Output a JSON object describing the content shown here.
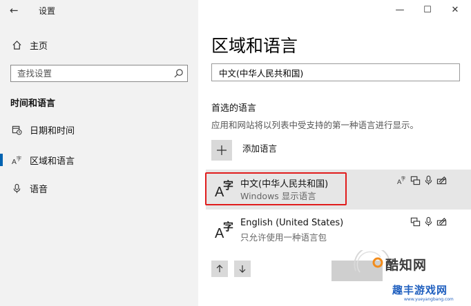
{
  "window": {
    "app_title": "设置",
    "back_glyph": "←",
    "minimize_glyph": "—",
    "maximize_glyph": "☐",
    "close_glyph": "✕"
  },
  "sidebar": {
    "home_label": "主页",
    "search_placeholder": "查找设置",
    "section_header": "时间和语言",
    "items": [
      {
        "label": "日期和时间",
        "icon": "calendar-clock-icon",
        "active": false
      },
      {
        "label": "区域和语言",
        "icon": "language-icon",
        "active": true
      },
      {
        "label": "语音",
        "icon": "microphone-icon",
        "active": false
      }
    ]
  },
  "main": {
    "page_title": "区域和语言",
    "country_value": "中文(中华人民共和国)",
    "preferred_title": "首选的语言",
    "preferred_desc": "应用和网站将以列表中受支持的第一种语言进行显示。",
    "add_language_label": "添加语言",
    "languages": [
      {
        "name": "中文(中华人民共和国)",
        "sub": "Windows 显示语言",
        "selected": true
      },
      {
        "name": "English (United States)",
        "sub": "只允许使用一种语言包",
        "selected": false
      }
    ]
  },
  "watermark": {
    "text1": "酷知网",
    "text2": "趣丰游戏网",
    "url": "www.yueyangbang.com"
  },
  "colors": {
    "accent": "#0063b1",
    "highlight": "#e01b1b",
    "sidebar_bg": "#f2f2f2"
  }
}
